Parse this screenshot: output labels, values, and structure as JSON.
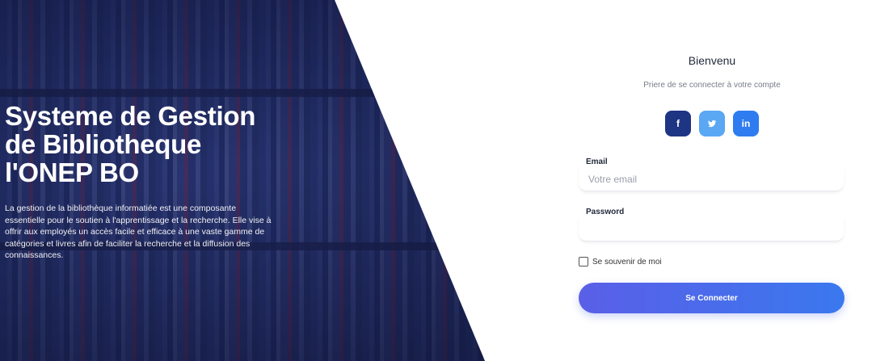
{
  "hero": {
    "title_line1": "Systeme de Gestion",
    "title_line2": "de Bibliotheque",
    "title_line3": "l'ONEP BO",
    "description": "La gestion de la bibliothèque informatiée est une composante essentielle pour le soutien à l'apprentissage et la recherche. Elle vise à offrir aux employés un accès facile et efficace à une vaste gamme de catégories et livres afin de faciliter la recherche et la diffusion des connaissances."
  },
  "login": {
    "welcome": "Bienvenu",
    "subtitle": "Priere de se connecter à votre compte",
    "social": {
      "facebook": "f",
      "twitter": "🐦",
      "linkedin": "in"
    },
    "email": {
      "label": "Email",
      "placeholder": "Votre email",
      "value": ""
    },
    "password": {
      "label": "Password",
      "placeholder": "",
      "value": ""
    },
    "remember_label": "Se souvenir de moi",
    "remember_checked": false,
    "submit_label": "Se Connecter"
  },
  "colors": {
    "facebook": "#1e3584",
    "twitter": "#5aa7f3",
    "linkedin": "#2f7cf0",
    "accent_start": "#5a5fe8",
    "accent_end": "#3a78ee"
  }
}
